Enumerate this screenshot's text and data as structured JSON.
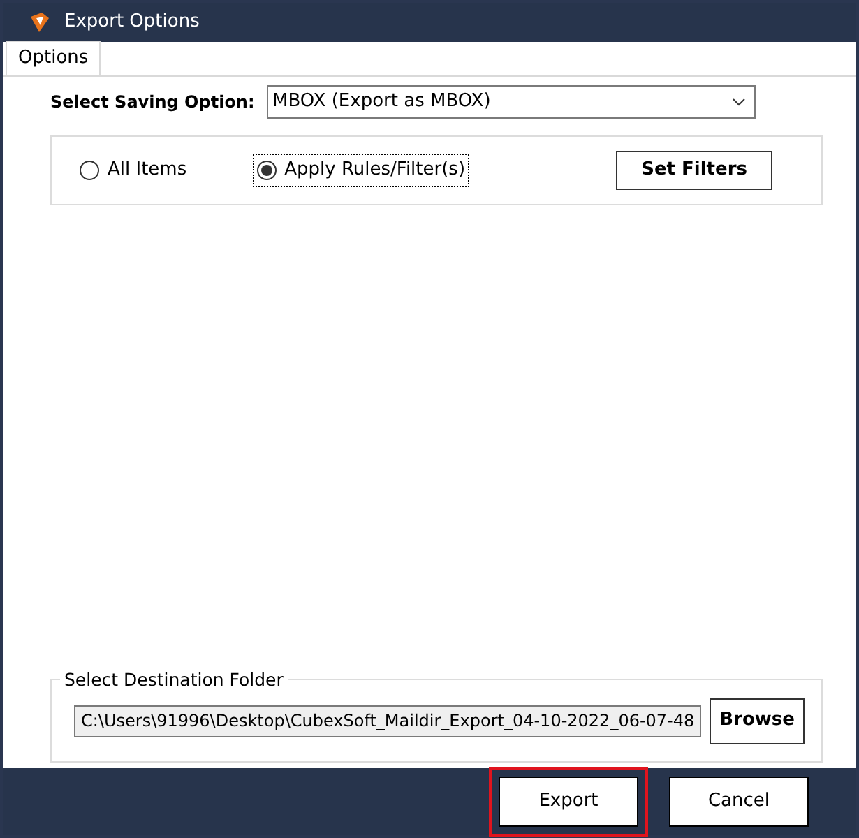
{
  "window": {
    "title": "Export Options"
  },
  "tabs": [
    {
      "label": "Options",
      "selected": true
    }
  ],
  "saving_option": {
    "label": "Select Saving Option:",
    "value": "MBOX (Export as MBOX)"
  },
  "scope_options": [
    {
      "label": "All Items",
      "selected": false,
      "focused": false
    },
    {
      "label": "Apply Rules/Filter(s)",
      "selected": true,
      "focused": true
    }
  ],
  "set_filters_button": "Set Filters",
  "destination": {
    "legend": "Select Destination Folder",
    "path": "C:\\Users\\91996\\Desktop\\CubexSoft_Maildir_Export_04-10-2022_06-07-48",
    "browse_button": "Browse"
  },
  "footer_buttons": [
    {
      "label": "Export",
      "highlighted": true
    },
    {
      "label": "Cancel",
      "highlighted": false
    }
  ]
}
